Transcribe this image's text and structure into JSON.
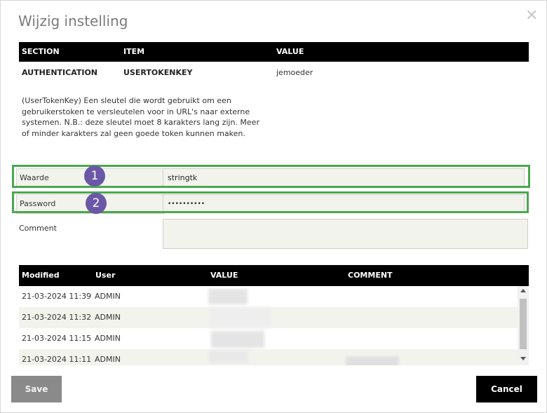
{
  "dialog": {
    "title": "Wijzig instelling",
    "close_glyph": "✕"
  },
  "settings_table": {
    "headers": [
      "SECTION",
      "ITEM",
      "VALUE"
    ],
    "row": {
      "section": "AUTHENTICATION",
      "item": "USERTOKENKEY",
      "value": "jemoeder"
    }
  },
  "description": "(UserTokenKey) Een sleutel die wordt gebruikt om een gebruikerstoken te versleutelen voor in URL's naar externe systemen. N.B.: deze sleutel moet 8 karakters lang zijn. Meer of minder karakters zal geen goede token kunnen maken.",
  "form": {
    "waarde_label": "Waarde",
    "waarde_value": "stringtk",
    "password_label": "Password",
    "password_value": "••••••••••",
    "comment_label": "Comment",
    "comment_value": ""
  },
  "annotations": {
    "badge_1": "1",
    "badge_2": "2",
    "highlight_color": "#4aa84e",
    "badge_color": "#6a58a6"
  },
  "history": {
    "headers": [
      "Modified",
      "User",
      "VALUE",
      "COMMENT"
    ],
    "rows": [
      {
        "modified": "21-03-2024 11:39",
        "user": "ADMIN"
      },
      {
        "modified": "21-03-2024 11:32",
        "user": "ADMIN"
      },
      {
        "modified": "21-03-2024 11:15",
        "user": "ADMIN"
      },
      {
        "modified": "21-03-2024 11:11",
        "user": "ADMIN"
      }
    ]
  },
  "buttons": {
    "save": "Save",
    "cancel": "Cancel"
  }
}
